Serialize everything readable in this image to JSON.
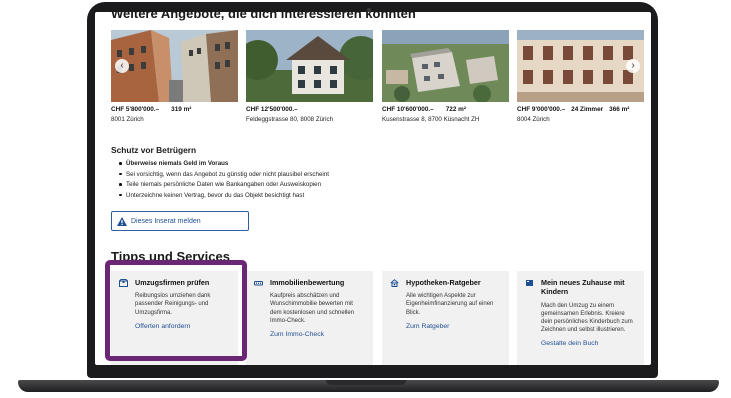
{
  "sections": {
    "offers_title": "Weitere Angebote, die dich interessieren könnten",
    "fraud_title": "Schutz vor Betrügern",
    "tips_title": "Tipps und Services"
  },
  "listings": [
    {
      "price": "CHF 5'800'000.–",
      "rooms": "",
      "area": "319 m²",
      "address": "8001 Zürich"
    },
    {
      "price": "CHF 12'500'000.–",
      "rooms": "",
      "area": "",
      "address": "Feldeggstrasse 80, 8008 Zürich"
    },
    {
      "price": "CHF 10'600'000.–",
      "rooms": "",
      "area": "722 m²",
      "address": "Kusenstrasse 8, 8700 Küsnacht ZH"
    },
    {
      "price": "CHF 9'000'000.–",
      "rooms": "24 Zimmer",
      "area": "366 m²",
      "address": "8004 Zürich"
    }
  ],
  "carousel": {
    "prev": "‹",
    "next": "›"
  },
  "fraud": {
    "items": [
      "Überweise niemals Geld im Voraus",
      "Sei vorsichtig, wenn das Angebot zu günstig oder nicht plausibel erscheint",
      "Teile niemals persönliche Daten wie Bankangaben oder Ausweiskopien",
      "Unterzeichne keinen Vertrag, bevor du das Objekt besichtigt hast"
    ],
    "report_label": "Dieses Inserat melden"
  },
  "tips": [
    {
      "title": "Umzugsfirmen prüfen",
      "desc": "Reibungslos umziehen dank passender Reinigungs- und Umzugsfirma.",
      "link": "Offerten anfordern",
      "icon": "moving-box-icon"
    },
    {
      "title": "Immobilienbewertung",
      "desc": "Kaufpreis abschätzen und Wunschimmobilie bewerten mit dem kostenlosen und schnellen Immo-Check.",
      "link": "Zum Immo-Check",
      "icon": "valuation-icon"
    },
    {
      "title": "Hypotheken-Ratgeber",
      "desc": "Alle wichtigen Aspekte zur Eigenheimfinanzierung auf einen Blick.",
      "link": "Zum Ratgeber",
      "icon": "mortgage-icon"
    },
    {
      "title": "Mein neues Zuhause mit Kindern",
      "desc": "Mach den Umzug zu einem gemeinsamen Erlebnis. Kreiere dein persönliches Kinderbuch zum Zeichnen und selbst illustrieren.",
      "link": "Gestalte dein Buch",
      "icon": "book-icon"
    }
  ],
  "colors": {
    "link": "#1f4f93",
    "highlight": "#6b2775",
    "tip_bg": "#f1f1f1"
  }
}
